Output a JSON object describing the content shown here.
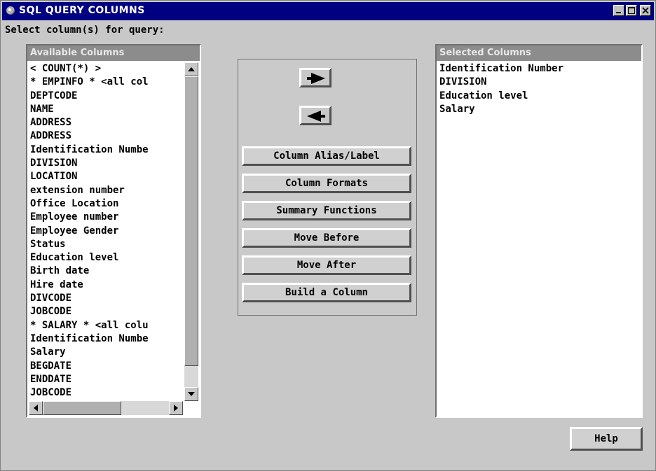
{
  "window": {
    "title": "SQL QUERY COLUMNS"
  },
  "prompt": "Select column(s) for query:",
  "available": {
    "header": "Available Columns",
    "items": [
      "< COUNT(*) >",
      "* EMPINFO * <all col",
      "DEPTCODE",
      "NAME",
      "ADDRESS",
      "ADDRESS",
      "Identification Numbe",
      "DIVISION",
      "LOCATION",
      "extension number",
      "Office Location",
      "Employee number",
      "Employee Gender",
      "Status",
      "Education level",
      "Birth date",
      "Hire date",
      "DIVCODE",
      "JOBCODE",
      "* SALARY * <all colu",
      "Identification Numbe",
      "Salary",
      "BEGDATE",
      "ENDDATE",
      "JOBCODE"
    ]
  },
  "selected": {
    "header": "Selected Columns",
    "items": [
      "Identification Number",
      "DIVISION",
      "Education level",
      "Salary"
    ]
  },
  "buttons": {
    "column_alias": "Column Alias/Label",
    "column_formats": "Column Formats",
    "summary_functions": "Summary Functions",
    "move_before": "Move Before",
    "move_after": "Move After",
    "build_column": "Build a Column",
    "help": "Help"
  },
  "icons": {
    "add": "right-arrow-icon",
    "remove": "left-arrow-icon",
    "window_controls": [
      "minimize-icon",
      "maximize-icon",
      "close-icon"
    ]
  }
}
